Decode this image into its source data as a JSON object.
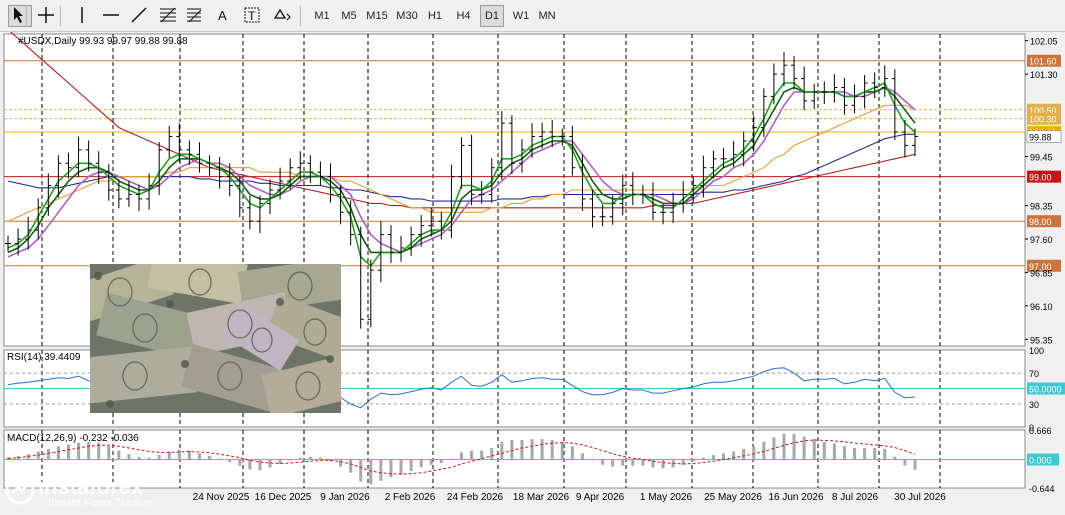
{
  "toolbar": {
    "timeframes": [
      "M1",
      "M5",
      "M15",
      "M30",
      "H1",
      "H4",
      "D1",
      "W1",
      "MN"
    ],
    "active_timeframe": "D1",
    "tools": [
      "cursor-icon",
      "crosshair-icon",
      "vertical-line-icon",
      "horizontal-line-icon",
      "trendline-icon",
      "fibonacci-icon",
      "fibo-fan-icon",
      "text-icon",
      "label-icon",
      "shapes-icon"
    ]
  },
  "chart_data": {
    "type": "line",
    "symbol_header": "#USDX,Daily  99.93 99.97 99.88 99.88",
    "price_axis": {
      "ylim": [
        95.2,
        102.2
      ],
      "tick_labels": [
        "102.05",
        "101.30",
        "99.45",
        "98.35",
        "97.60",
        "96.85",
        "96.10",
        "95.35"
      ],
      "tick_values": [
        102.05,
        101.3,
        99.45,
        98.35,
        97.6,
        96.85,
        96.1,
        95.35
      ]
    },
    "level_lines": [
      {
        "label": "101.60",
        "value": 101.6,
        "color": "#c8743c"
      },
      {
        "label": "100.50",
        "value": 100.5,
        "color": "#e0b050"
      },
      {
        "label": "100.30",
        "value": 100.3,
        "color": "#e0b050"
      },
      {
        "label": "100.00",
        "value": 100.0,
        "color": "#f0b000"
      },
      {
        "label": "99.00",
        "value": 99.0,
        "color": "#c01818"
      },
      {
        "label": "98.00",
        "value": 98.0,
        "color": "#c8743c"
      },
      {
        "label": "97.00",
        "value": 97.0,
        "color": "#c8743c"
      }
    ],
    "current_price_label": "99.88",
    "date_labels": [
      "24 Nov 2025",
      "16 Dec 2025",
      "9 Jan 2026",
      "2 Feb 2026",
      "24 Feb 2026",
      "18 Mar 2026",
      "9 Apr 2026",
      "1 May 2026",
      "25 May 2026",
      "16 Jun 2026",
      "8 Jul 2026",
      "30 Jul 2026"
    ],
    "series": [
      {
        "name": "#USDX,Daily",
        "color": "#000000",
        "values": [
          97.5,
          97.6,
          97.8,
          98.3,
          98.8,
          99.3,
          99.2,
          99.6,
          99.3,
          99.1,
          98.7,
          98.5,
          98.6,
          98.5,
          98.8,
          99.6,
          99.9,
          99.6,
          99.5,
          99.3,
          99.2,
          99.0,
          98.8,
          98.3,
          98.0,
          98.4,
          98.7,
          98.9,
          99.2,
          99.3,
          99.1,
          99.0,
          98.6,
          98.2,
          97.7,
          95.8,
          96.9,
          97.7,
          97.3,
          97.4,
          97.7,
          97.9,
          98.0,
          97.8,
          99.0,
          99.7,
          98.6,
          98.6,
          99.2,
          100.2,
          99.3,
          99.6,
          99.9,
          100.0,
          99.9,
          99.9,
          99.2,
          98.5,
          98.1,
          98.1,
          98.4,
          98.8,
          98.6,
          98.6,
          98.2,
          98.2,
          98.4,
          98.6,
          98.8,
          99.2,
          99.4,
          99.4,
          99.5,
          99.8,
          100.1,
          100.8,
          101.3,
          101.5,
          101.2,
          100.7,
          100.9,
          100.9,
          101.0,
          100.6,
          100.8,
          101.1,
          101.0,
          101.2,
          100.0,
          99.7,
          99.9
        ]
      },
      {
        "name": "",
        "color": "#22a022",
        "values": [
          97.4,
          97.5,
          97.7,
          98.1,
          98.5,
          98.9,
          99.1,
          99.3,
          99.3,
          99.2,
          99.0,
          98.8,
          98.7,
          98.6,
          98.7,
          99.1,
          99.4,
          99.5,
          99.5,
          99.4,
          99.3,
          99.2,
          99.0,
          98.7,
          98.4,
          98.3,
          98.5,
          98.7,
          98.9,
          99.1,
          99.1,
          99.0,
          98.8,
          98.5,
          98.1,
          97.2,
          97.0,
          97.3,
          97.3,
          97.3,
          97.5,
          97.7,
          97.8,
          97.8,
          98.2,
          98.8,
          98.8,
          98.7,
          98.9,
          99.4,
          99.4,
          99.5,
          99.7,
          99.8,
          99.9,
          99.9,
          99.6,
          99.1,
          98.7,
          98.4,
          98.4,
          98.6,
          98.6,
          98.6,
          98.4,
          98.3,
          98.3,
          98.5,
          98.7,
          98.9,
          99.1,
          99.3,
          99.4,
          99.6,
          99.9,
          100.3,
          100.8,
          101.1,
          101.1,
          100.9,
          100.9,
          100.9,
          100.9,
          100.8,
          100.8,
          100.9,
          101.0,
          101.1,
          100.6,
          100.2,
          100.0
        ]
      },
      {
        "name": "",
        "color": "#106010",
        "values": [
          97.3,
          97.4,
          97.6,
          97.9,
          98.3,
          98.6,
          98.9,
          99.1,
          99.2,
          99.2,
          99.1,
          98.9,
          98.8,
          98.7,
          98.7,
          98.9,
          99.2,
          99.4,
          99.4,
          99.4,
          99.3,
          99.2,
          99.1,
          98.9,
          98.6,
          98.5,
          98.5,
          98.6,
          98.8,
          99.0,
          99.0,
          99.0,
          98.9,
          98.7,
          98.3,
          97.7,
          97.3,
          97.3,
          97.3,
          97.3,
          97.4,
          97.6,
          97.7,
          97.8,
          98.0,
          98.5,
          98.7,
          98.7,
          98.8,
          99.1,
          99.3,
          99.4,
          99.6,
          99.7,
          99.8,
          99.8,
          99.7,
          99.3,
          98.9,
          98.6,
          98.5,
          98.5,
          98.6,
          98.6,
          98.5,
          98.4,
          98.4,
          98.4,
          98.6,
          98.8,
          99.0,
          99.2,
          99.3,
          99.5,
          99.7,
          100.1,
          100.5,
          100.9,
          101.0,
          100.9,
          100.9,
          100.9,
          100.9,
          100.8,
          100.8,
          100.9,
          100.9,
          101.0,
          100.8,
          100.5,
          100.2
        ]
      },
      {
        "name": "",
        "color": "#b060c0",
        "values": [
          97.2,
          97.3,
          97.4,
          97.6,
          97.9,
          98.2,
          98.5,
          98.8,
          99.0,
          99.1,
          99.1,
          99.0,
          98.9,
          98.8,
          98.7,
          98.8,
          99.0,
          99.2,
          99.3,
          99.4,
          99.3,
          99.3,
          99.2,
          99.0,
          98.8,
          98.7,
          98.6,
          98.6,
          98.7,
          98.9,
          99.0,
          99.0,
          99.0,
          98.8,
          98.6,
          98.1,
          97.7,
          97.5,
          97.4,
          97.3,
          97.4,
          97.5,
          97.6,
          97.7,
          97.9,
          98.2,
          98.5,
          98.6,
          98.7,
          98.9,
          99.1,
          99.3,
          99.5,
          99.6,
          99.7,
          99.8,
          99.8,
          99.5,
          99.2,
          98.9,
          98.7,
          98.6,
          98.6,
          98.6,
          98.6,
          98.5,
          98.4,
          98.4,
          98.5,
          98.7,
          98.9,
          99.0,
          99.2,
          99.3,
          99.5,
          99.8,
          100.2,
          100.6,
          100.9,
          100.9,
          100.9,
          100.9,
          100.9,
          100.9,
          100.8,
          100.8,
          100.9,
          101.0,
          100.9,
          100.7,
          100.5
        ]
      },
      {
        "name": "",
        "color": "#e0a030",
        "values": [
          98.0,
          98.1,
          98.2,
          98.3,
          98.4,
          98.5,
          98.6,
          98.7,
          98.8,
          98.9,
          98.9,
          99.0,
          99.0,
          99.0,
          99.0,
          99.0,
          99.1,
          99.1,
          99.2,
          99.2,
          99.2,
          99.2,
          99.2,
          99.2,
          99.2,
          99.1,
          99.1,
          99.1,
          99.1,
          99.0,
          99.0,
          99.0,
          99.0,
          98.9,
          98.9,
          98.8,
          98.7,
          98.6,
          98.5,
          98.4,
          98.3,
          98.3,
          98.2,
          98.2,
          98.2,
          98.2,
          98.2,
          98.2,
          98.3,
          98.3,
          98.4,
          98.4,
          98.5,
          98.5,
          98.6,
          98.6,
          98.7,
          98.7,
          98.7,
          98.7,
          98.7,
          98.7,
          98.7,
          98.7,
          98.7,
          98.7,
          98.7,
          98.7,
          98.7,
          98.8,
          98.8,
          98.8,
          98.9,
          99.0,
          99.1,
          99.2,
          99.4,
          99.5,
          99.7,
          99.8,
          99.9,
          100.0,
          100.1,
          100.2,
          100.3,
          100.4,
          100.5,
          100.6,
          100.6,
          100.6,
          100.5
        ]
      },
      {
        "name": "",
        "color": "#2a2a8a",
        "values": [
          98.9,
          98.85,
          98.8,
          98.75,
          98.75,
          98.75,
          98.8,
          98.85,
          98.9,
          98.95,
          99.0,
          99.0,
          99.0,
          99.0,
          99.0,
          99.0,
          99.0,
          99.0,
          99.0,
          98.95,
          98.95,
          98.9,
          98.9,
          98.9,
          98.9,
          98.85,
          98.85,
          98.8,
          98.8,
          98.8,
          98.8,
          98.8,
          98.75,
          98.75,
          98.7,
          98.7,
          98.65,
          98.6,
          98.55,
          98.55,
          98.5,
          98.5,
          98.45,
          98.45,
          98.45,
          98.45,
          98.45,
          98.45,
          98.45,
          98.5,
          98.5,
          98.5,
          98.55,
          98.55,
          98.6,
          98.6,
          98.6,
          98.6,
          98.6,
          98.6,
          98.6,
          98.6,
          98.6,
          98.6,
          98.6,
          98.6,
          98.6,
          98.6,
          98.6,
          98.65,
          98.65,
          98.65,
          98.7,
          98.7,
          98.75,
          98.8,
          98.85,
          98.9,
          99.0,
          99.05,
          99.15,
          99.25,
          99.35,
          99.45,
          99.55,
          99.65,
          99.75,
          99.85,
          99.9,
          99.95,
          99.95
        ]
      },
      {
        "name": "",
        "color": "#b02020",
        "values": [
          102.3,
          102.1,
          101.9,
          101.7,
          101.5,
          101.3,
          101.1,
          100.9,
          100.7,
          100.5,
          100.3,
          100.1,
          100.0,
          99.9,
          99.8,
          99.7,
          99.6,
          99.5,
          99.4,
          99.3,
          99.2,
          99.15,
          99.1,
          99.05,
          99.0,
          98.95,
          98.9,
          98.85,
          98.8,
          98.75,
          98.7,
          98.65,
          98.6,
          98.55,
          98.5,
          98.45,
          98.4,
          98.4,
          98.35,
          98.35,
          98.3,
          98.3,
          98.3,
          98.3,
          98.3,
          98.3,
          98.3,
          98.3,
          98.3,
          98.3,
          98.3,
          98.3,
          98.3,
          98.3,
          98.3,
          98.3,
          98.3,
          98.3,
          98.3,
          98.3,
          98.3,
          98.3,
          98.3,
          98.3,
          98.35,
          98.35,
          98.35,
          98.4,
          98.4,
          98.45,
          98.5,
          98.55,
          98.6,
          98.65,
          98.7,
          98.75,
          98.8,
          98.85,
          98.9,
          98.95,
          99.0,
          99.05,
          99.1,
          99.15,
          99.2,
          99.25,
          99.3,
          99.35,
          99.4,
          99.45,
          99.5
        ]
      }
    ]
  },
  "rsi": {
    "label": "RSI(14) 39.4409",
    "ylim": [
      0,
      100
    ],
    "tick_labels": [
      "100",
      "70",
      "50.0000",
      "30",
      "0"
    ],
    "tick_values": [
      100,
      70,
      50,
      30,
      0
    ],
    "level_value": 50,
    "values": [
      55,
      57,
      58,
      60,
      62,
      64,
      63,
      66,
      60,
      55,
      50,
      48,
      49,
      48,
      52,
      60,
      64,
      58,
      55,
      52,
      50,
      48,
      44,
      40,
      38,
      42,
      47,
      50,
      54,
      56,
      52,
      50,
      44,
      38,
      30,
      25,
      36,
      44,
      42,
      43,
      46,
      49,
      51,
      48,
      58,
      66,
      54,
      53,
      58,
      68,
      58,
      60,
      63,
      64,
      62,
      62,
      54,
      46,
      42,
      42,
      45,
      50,
      48,
      48,
      44,
      44,
      47,
      50,
      52,
      56,
      58,
      58,
      60,
      63,
      66,
      72,
      76,
      77,
      70,
      60,
      62,
      62,
      63,
      56,
      58,
      62,
      60,
      63,
      45,
      38,
      39
    ]
  },
  "macd": {
    "label": "MACD(12,26,9) -0.232 -0.036",
    "ylim": [
      -0.644,
      0.666
    ],
    "tick_labels": [
      "0.666",
      "0.000",
      "-0.644"
    ],
    "tick_values": [
      0.666,
      0.0,
      -0.644
    ],
    "histogram": [
      0.05,
      0.08,
      0.12,
      0.18,
      0.24,
      0.3,
      0.34,
      0.38,
      0.4,
      0.38,
      0.3,
      0.2,
      0.12,
      0.06,
      0.04,
      0.1,
      0.18,
      0.22,
      0.2,
      0.14,
      0.08,
      0.02,
      -0.06,
      -0.14,
      -0.22,
      -0.24,
      -0.18,
      -0.1,
      -0.02,
      0.04,
      0.06,
      0.04,
      -0.04,
      -0.16,
      -0.3,
      -0.5,
      -0.56,
      -0.48,
      -0.4,
      -0.34,
      -0.26,
      -0.18,
      -0.12,
      -0.08,
      0.02,
      0.16,
      0.2,
      0.2,
      0.26,
      0.4,
      0.44,
      0.44,
      0.46,
      0.46,
      0.44,
      0.4,
      0.3,
      0.14,
      -0.02,
      -0.12,
      -0.16,
      -0.14,
      -0.14,
      -0.14,
      -0.18,
      -0.2,
      -0.18,
      -0.12,
      -0.04,
      0.04,
      0.1,
      0.14,
      0.18,
      0.24,
      0.3,
      0.4,
      0.5,
      0.58,
      0.58,
      0.52,
      0.46,
      0.4,
      0.36,
      0.3,
      0.26,
      0.26,
      0.26,
      0.24,
      0.06,
      -0.14,
      -0.232
    ],
    "signal": [
      0.02,
      0.04,
      0.07,
      0.1,
      0.14,
      0.18,
      0.22,
      0.26,
      0.3,
      0.32,
      0.32,
      0.3,
      0.26,
      0.22,
      0.18,
      0.16,
      0.16,
      0.17,
      0.18,
      0.17,
      0.15,
      0.12,
      0.08,
      0.04,
      -0.02,
      -0.06,
      -0.08,
      -0.09,
      -0.08,
      -0.06,
      -0.04,
      -0.02,
      -0.02,
      -0.05,
      -0.1,
      -0.18,
      -0.26,
      -0.3,
      -0.32,
      -0.33,
      -0.32,
      -0.3,
      -0.26,
      -0.22,
      -0.18,
      -0.1,
      -0.04,
      0.02,
      0.08,
      0.14,
      0.2,
      0.26,
      0.3,
      0.34,
      0.37,
      0.38,
      0.37,
      0.33,
      0.27,
      0.2,
      0.13,
      0.07,
      0.03,
      0.0,
      -0.04,
      -0.07,
      -0.09,
      -0.1,
      -0.09,
      -0.07,
      -0.04,
      0.0,
      0.04,
      0.08,
      0.13,
      0.18,
      0.25,
      0.32,
      0.38,
      0.42,
      0.44,
      0.43,
      0.42,
      0.4,
      0.37,
      0.35,
      0.33,
      0.31,
      0.27,
      0.2,
      0.12
    ]
  },
  "watermark": {
    "brand": "instaforex",
    "tagline": "Instant Forex Trading"
  }
}
